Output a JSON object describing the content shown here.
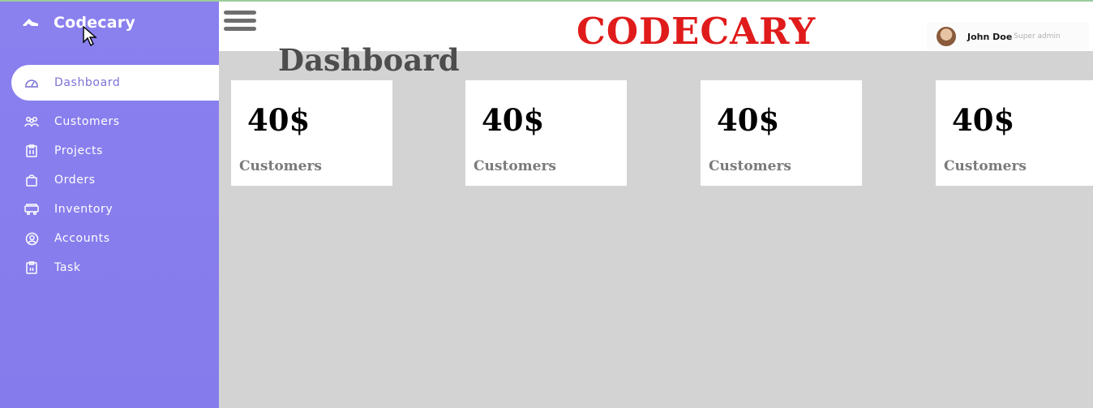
{
  "colors": {
    "sidebar": "#8780ed",
    "title_red": "#e01b1b",
    "content_bg": "#d3d3d3",
    "active_text": "#7b73d6"
  },
  "brand": {
    "name": "Codecary",
    "icon": "plane-icon"
  },
  "sidebar": {
    "items": [
      {
        "label": "Dashboard",
        "icon": "dashboard-gauge-icon",
        "active": true
      },
      {
        "label": "Customers",
        "icon": "customers-group-icon"
      },
      {
        "label": "Projects",
        "icon": "clipboard-icon"
      },
      {
        "label": "Orders",
        "icon": "shopping-bag-icon"
      },
      {
        "label": "Inventory",
        "icon": "truck-icon"
      },
      {
        "label": "Accounts",
        "icon": "account-circle-icon"
      },
      {
        "label": "Task",
        "icon": "task-clipboard-icon"
      }
    ]
  },
  "header": {
    "menu_icon": "hamburger-menu-icon",
    "title": "CODECARY",
    "user": {
      "name": "John Doe",
      "role": "Super admin"
    }
  },
  "main": {
    "title": "Dashboard",
    "cards": [
      {
        "value": "40$",
        "label": "Customers"
      },
      {
        "value": "40$",
        "label": "Customers"
      },
      {
        "value": "40$",
        "label": "Customers"
      },
      {
        "value": "40$",
        "label": "Customers"
      }
    ]
  }
}
